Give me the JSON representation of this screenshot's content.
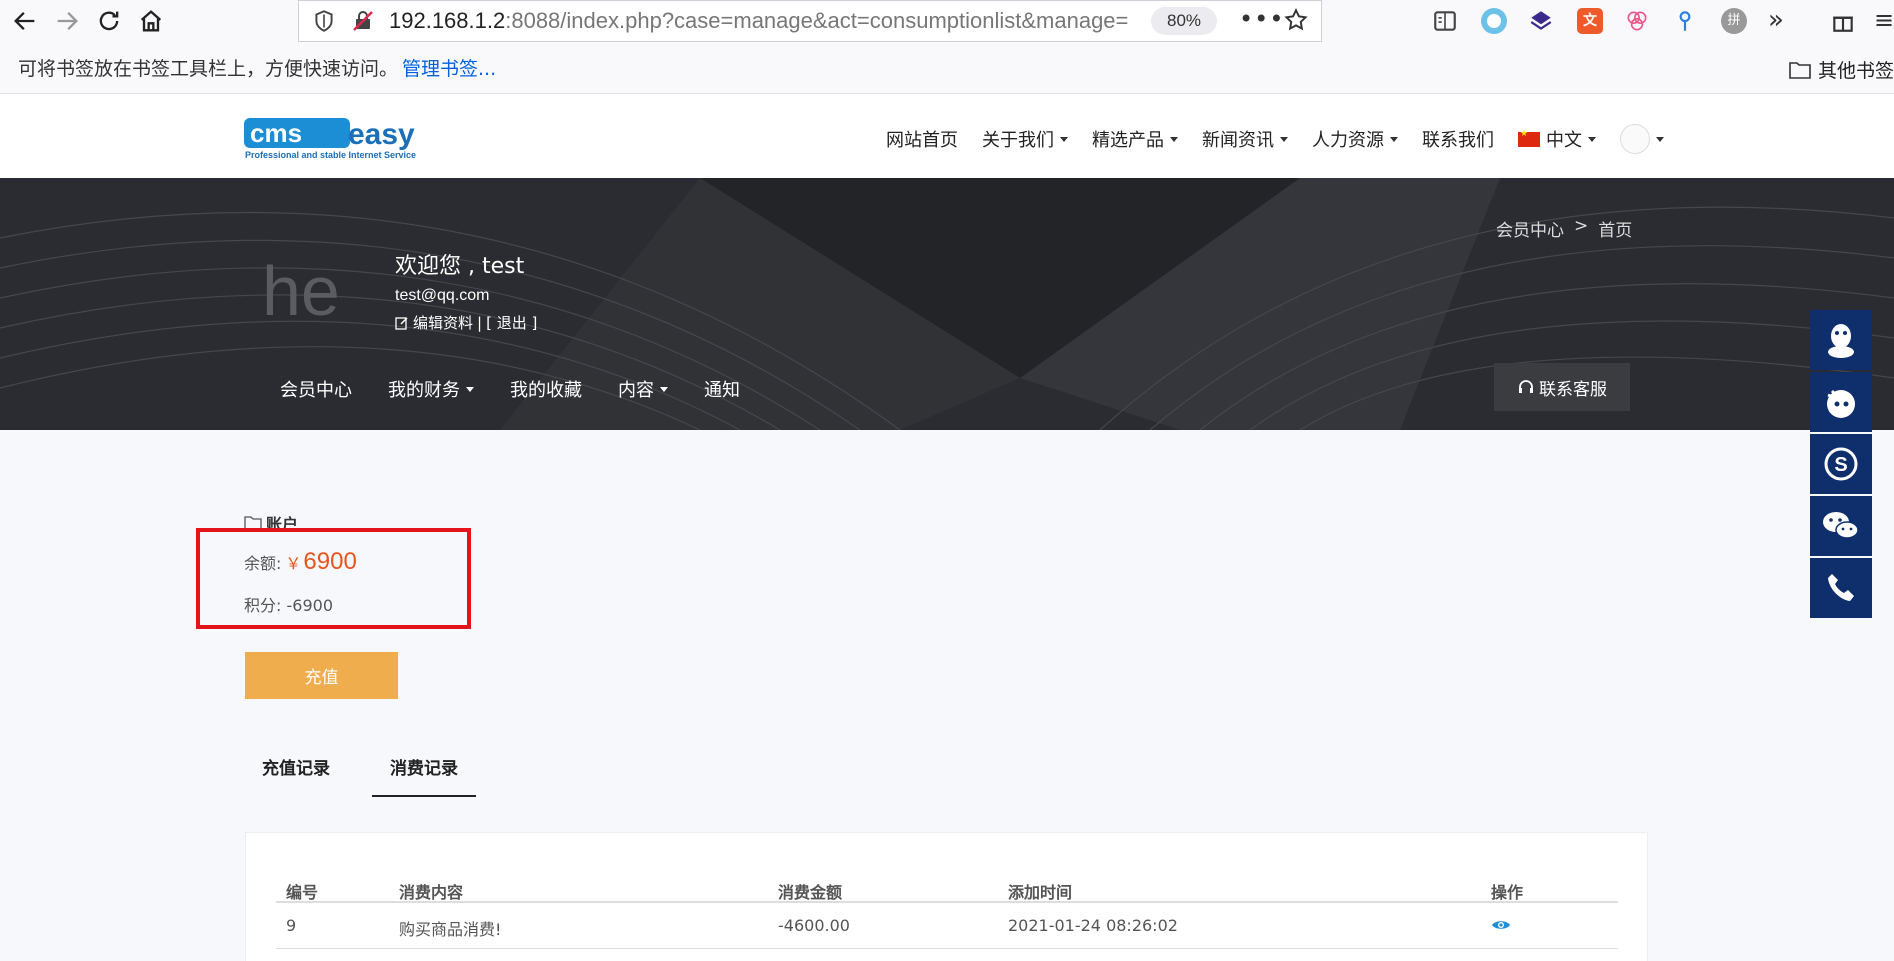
{
  "browser": {
    "url_host": "192.168.1.2",
    "url_rest": ":8088/index.php?case=manage&act=consumptionlist&manage=",
    "zoom": "80%",
    "bookmark_hint": "可将书签放在书签工具栏上，方便快速访问。",
    "bookmark_manage": "管理书签...",
    "other_bookmarks": "其他书签"
  },
  "site": {
    "logo_tagline": "Professional and stable Internet Service",
    "nav": [
      {
        "label": "网站首页"
      },
      {
        "label": "关于我们"
      },
      {
        "label": "精选产品"
      },
      {
        "label": "新闻资讯"
      },
      {
        "label": "人力资源"
      },
      {
        "label": "联系我们"
      },
      {
        "label": "中文"
      }
    ]
  },
  "banner": {
    "avatar_text": "he",
    "welcome": "欢迎您 , test",
    "email": "test@qq.com",
    "edit_profile": "编辑资料",
    "logout": "[ 退出 ]",
    "breadcrumb_parent": "会员中心",
    "breadcrumb_sep": ">",
    "breadcrumb_current": "首页",
    "member_nav": [
      {
        "label": "会员中心"
      },
      {
        "label": "我的财务"
      },
      {
        "label": "我的收藏"
      },
      {
        "label": "内容"
      },
      {
        "label": "通知"
      }
    ],
    "contact_service": "联系客服"
  },
  "account": {
    "title": "账户",
    "balance_label": "余额:",
    "currency": "￥",
    "balance_value": "6900",
    "points_label": "积分:",
    "points_value": "-6900",
    "recharge_button": "充值",
    "tabs": [
      {
        "label": "充值记录"
      },
      {
        "label": "消费记录"
      }
    ]
  },
  "table": {
    "headers": [
      "编号",
      "消费内容",
      "消费金额",
      "添加时间",
      "操作"
    ],
    "rows": [
      {
        "id": "9",
        "content": "购买商品消费!",
        "amount": "-4600.00",
        "time": "2021-01-24 08:26:02"
      }
    ]
  },
  "colors": {
    "accent_orange": "#f0ad4e",
    "balance_red": "#e8541e",
    "highlight_red": "#e3141c",
    "side_blue": "#0f2f6c",
    "banner_dark": "#2a2c31"
  }
}
